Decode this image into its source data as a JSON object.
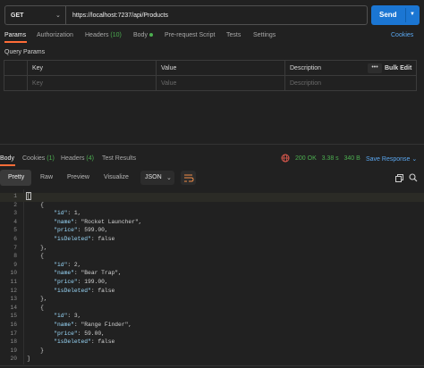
{
  "request": {
    "method": "GET",
    "url": "https://localhost:7237/api/Products",
    "send_label": "Send"
  },
  "request_tabs": [
    {
      "label": "Params",
      "active": true
    },
    {
      "label": "Authorization"
    },
    {
      "label": "Headers",
      "count": "(10)"
    },
    {
      "label": "Body"
    },
    {
      "label": "Pre-request Script"
    },
    {
      "label": "Tests"
    },
    {
      "label": "Settings"
    }
  ],
  "cookies_label": "Cookies",
  "query_params": {
    "title": "Query Params",
    "headers": [
      "Key",
      "Value",
      "Description"
    ],
    "placeholders": [
      "Key",
      "Value",
      "Description"
    ],
    "more_label": "•••",
    "bulk_edit_label": "Bulk Edit"
  },
  "response_tabs": [
    {
      "label": "Body",
      "active": true
    },
    {
      "label": "Cookies",
      "count": "(1)"
    },
    {
      "label": "Headers",
      "count": "(4)"
    },
    {
      "label": "Test Results"
    }
  ],
  "response_status": {
    "status": "200 OK",
    "time": "3.38 s",
    "size": "340 B",
    "save_label": "Save Response"
  },
  "view_modes": [
    "Pretty",
    "Raw",
    "Preview",
    "Visualize"
  ],
  "format": "JSON",
  "code_lines": [
    {
      "n": "1",
      "t": "["
    },
    {
      "n": "2",
      "t": "    {"
    },
    {
      "n": "3",
      "t": "        \"id\": 1,"
    },
    {
      "n": "4",
      "t": "        \"name\": \"Rocket Launcher\","
    },
    {
      "n": "5",
      "t": "        \"price\": 599.00,"
    },
    {
      "n": "6",
      "t": "        \"isDeleted\": false"
    },
    {
      "n": "7",
      "t": "    },"
    },
    {
      "n": "8",
      "t": "    {"
    },
    {
      "n": "9",
      "t": "        \"id\": 2,"
    },
    {
      "n": "10",
      "t": "        \"name\": \"Bear Trap\","
    },
    {
      "n": "11",
      "t": "        \"price\": 199.00,"
    },
    {
      "n": "12",
      "t": "        \"isDeleted\": false"
    },
    {
      "n": "13",
      "t": "    },"
    },
    {
      "n": "14",
      "t": "    {"
    },
    {
      "n": "15",
      "t": "        \"id\": 3,"
    },
    {
      "n": "16",
      "t": "        \"name\": \"Range Finder\","
    },
    {
      "n": "17",
      "t": "        \"price\": 59.00,"
    },
    {
      "n": "18",
      "t": "        \"isDeleted\": false"
    },
    {
      "n": "19",
      "t": "    }"
    },
    {
      "n": "20",
      "t": "]"
    }
  ],
  "colors": {
    "accent": "#ff6c37",
    "send": "#1b76d3",
    "success": "#4caf50",
    "link": "#5aa7f0"
  },
  "icons": [
    "chevron-down-icon",
    "globe-icon",
    "wrap-lines-icon",
    "copy-icon",
    "search-icon"
  ]
}
